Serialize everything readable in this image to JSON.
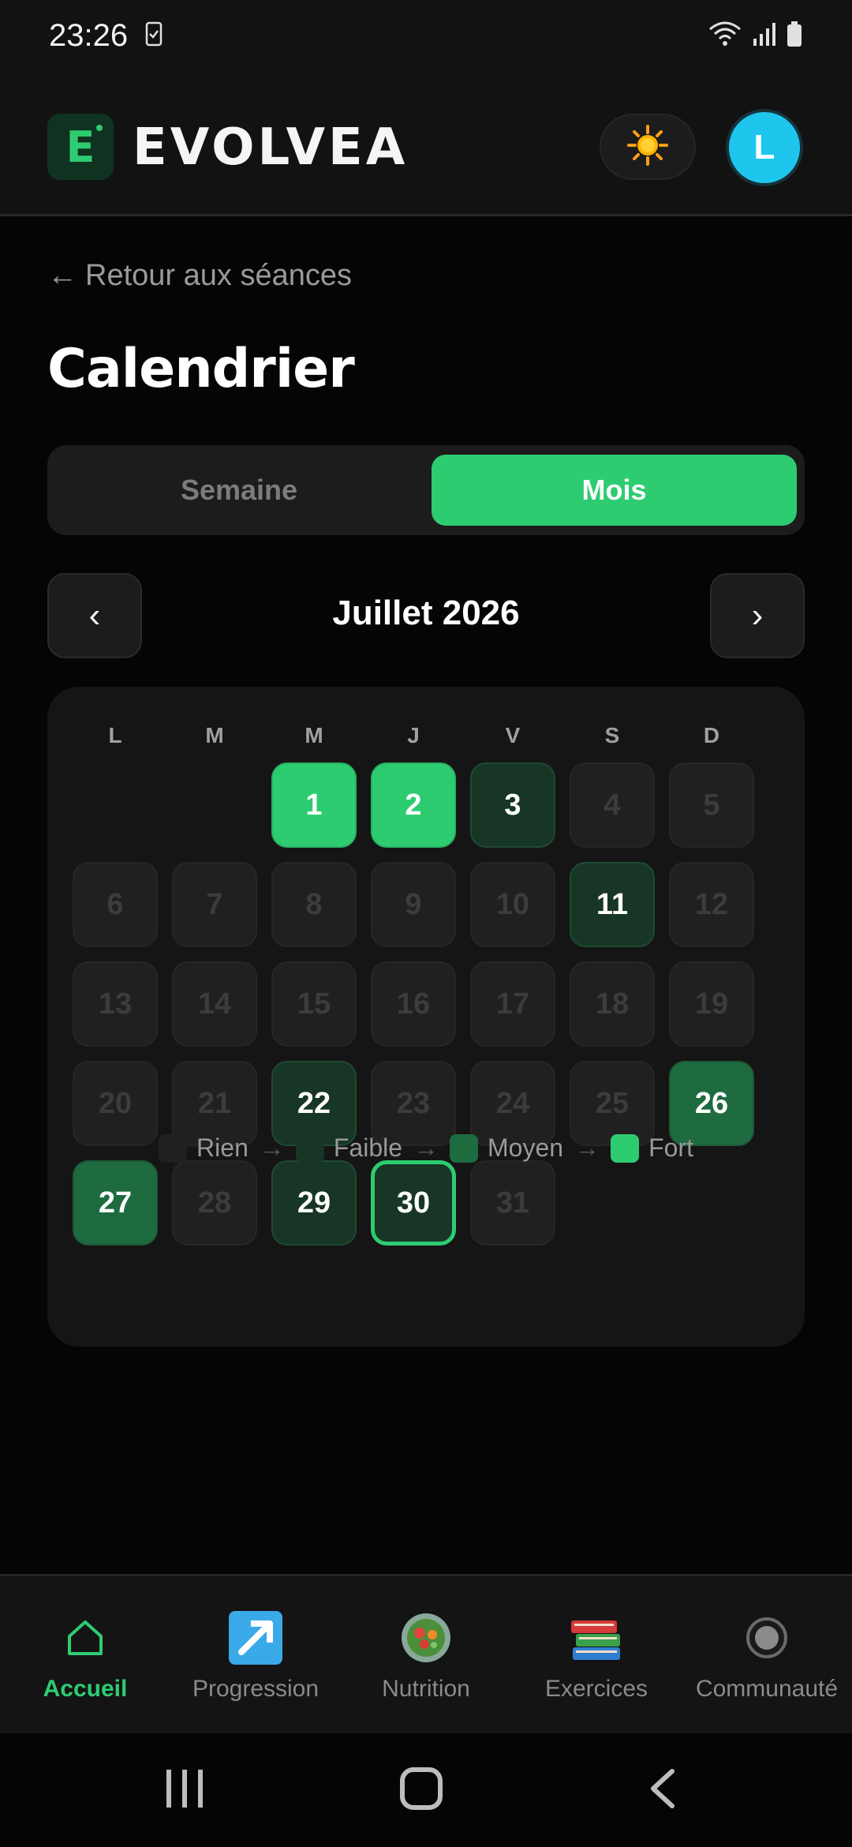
{
  "status_bar": {
    "time": "23:26"
  },
  "header": {
    "brand": "EVOLVEA",
    "logo_letter": "E",
    "avatar_initial": "L"
  },
  "back_link": {
    "arrow": "←",
    "label": "Retour aux séances"
  },
  "page_title": "Calendrier",
  "segmented": {
    "week": "Semaine",
    "month": "Mois",
    "selected": "Mois"
  },
  "month_nav": {
    "prev": "‹",
    "label": "Juillet 2026",
    "next": "›"
  },
  "calendar": {
    "weekdays": [
      "L",
      "M",
      "M",
      "J",
      "V",
      "S",
      "D"
    ],
    "first_weekday_index": 2,
    "today": 30,
    "days": [
      {
        "d": "1",
        "level": "high"
      },
      {
        "d": "2",
        "level": "high"
      },
      {
        "d": "3",
        "level": "low"
      },
      {
        "d": "4",
        "level": "none"
      },
      {
        "d": "5",
        "level": "none"
      },
      {
        "d": "6",
        "level": "none"
      },
      {
        "d": "7",
        "level": "none"
      },
      {
        "d": "8",
        "level": "none"
      },
      {
        "d": "9",
        "level": "none"
      },
      {
        "d": "10",
        "level": "none"
      },
      {
        "d": "11",
        "level": "low"
      },
      {
        "d": "12",
        "level": "none"
      },
      {
        "d": "13",
        "level": "none"
      },
      {
        "d": "14",
        "level": "none"
      },
      {
        "d": "15",
        "level": "none"
      },
      {
        "d": "16",
        "level": "none"
      },
      {
        "d": "17",
        "level": "none"
      },
      {
        "d": "18",
        "level": "none"
      },
      {
        "d": "19",
        "level": "none"
      },
      {
        "d": "20",
        "level": "none"
      },
      {
        "d": "21",
        "level": "none"
      },
      {
        "d": "22",
        "level": "low"
      },
      {
        "d": "23",
        "level": "none"
      },
      {
        "d": "24",
        "level": "none"
      },
      {
        "d": "25",
        "level": "none"
      },
      {
        "d": "26",
        "level": "mid"
      },
      {
        "d": "27",
        "level": "mid"
      },
      {
        "d": "28",
        "level": "none"
      },
      {
        "d": "29",
        "level": "low"
      },
      {
        "d": "30",
        "level": "low"
      },
      {
        "d": "31",
        "level": "none"
      }
    ],
    "legend": [
      {
        "label": "Rien",
        "level": "none"
      },
      {
        "label": "Faible",
        "level": "low"
      },
      {
        "label": "Moyen",
        "level": "mid"
      },
      {
        "label": "Fort",
        "level": "high"
      }
    ],
    "legend_arrow": "→"
  },
  "bottom_nav": {
    "items": [
      {
        "label": "Accueil",
        "icon": "home-icon",
        "active": true
      },
      {
        "label": "Progression",
        "icon": "trend-arrow-icon",
        "active": false
      },
      {
        "label": "Nutrition",
        "icon": "salad-bowl-icon",
        "active": false
      },
      {
        "label": "Exercices",
        "icon": "books-icon",
        "active": false
      },
      {
        "label": "Communauté",
        "icon": "radio-circle-icon",
        "active": false
      }
    ]
  },
  "colors": {
    "accent": "#2ecc71",
    "background": "#050505",
    "card": "#151515",
    "avatar": "#1ec6ee"
  }
}
